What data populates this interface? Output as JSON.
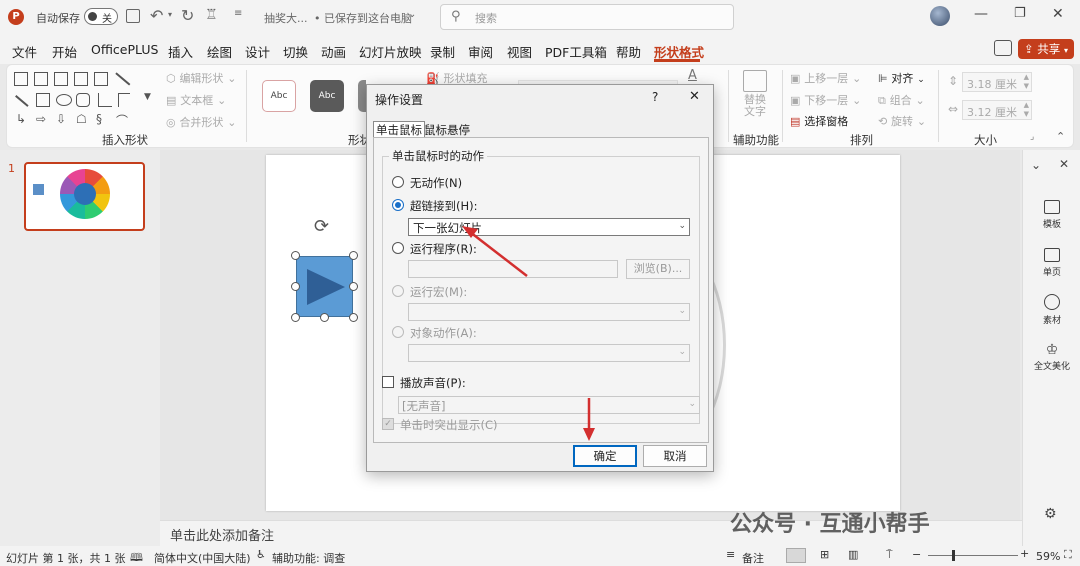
{
  "titlebar": {
    "autosave_label": "自动保存",
    "autosave_toggle": "关",
    "doc_title": "抽奖大...",
    "save_state": "• 已保存到这台电脑",
    "search_placeholder": "搜索"
  },
  "menu": {
    "items": [
      "文件",
      "开始",
      "OfficePLUS",
      "插入",
      "绘图",
      "设计",
      "切换",
      "动画",
      "幻灯片放映",
      "录制",
      "审阅",
      "视图",
      "PDF工具箱",
      "帮助",
      "形状格式"
    ],
    "share_label": "共享"
  },
  "ribbon": {
    "insert_shapes_label": "插入形状",
    "edit_shape": "编辑形状",
    "text_box": "文本框",
    "merge_shapes": "合并形状",
    "style_samples": [
      "Abc",
      "Abc",
      "Abc"
    ],
    "styles_label": "形状",
    "shape_fill": "形状填充",
    "alt_text": "替换文字",
    "accessibility_label": "辅助功能",
    "bring_forward": "上移一层",
    "send_backward": "下移一层",
    "selection_pane": "选择窗格",
    "align": "对齐",
    "group": "组合",
    "rotate": "旋转",
    "arrange_label": "排列",
    "height": "3.18 厘米",
    "width": "3.12 厘米",
    "size_label": "大小"
  },
  "thumbs": {
    "slide_number": "1"
  },
  "rightpane": {
    "items": [
      "模板",
      "单页",
      "素材",
      "全文美化"
    ]
  },
  "notes": {
    "placeholder": "单击此处添加备注"
  },
  "status": {
    "slide_info": "幻灯片 第 1 张，共 1 张",
    "language": "简体中文(中国大陆)",
    "accessibility": "辅助功能: 调查",
    "notes_btn": "备注",
    "zoom": "59%"
  },
  "watermark": "公众号 · 互通小帮手",
  "dialog": {
    "title": "操作设置",
    "help": "?",
    "close": "✕",
    "tabs": [
      "单击鼠标",
      "鼠标悬停"
    ],
    "group_title": "单击鼠标时的动作",
    "options": {
      "none": "无动作(N)",
      "hyperlink": "超链接到(H):",
      "hyperlink_value": "下一张幻灯片",
      "run_program": "运行程序(R):",
      "browse": "浏览(B)...",
      "run_macro": "运行宏(M):",
      "object_action": "对象动作(A):"
    },
    "play_sound": "播放声音(P):",
    "sound_value": "[无声音]",
    "highlight": "单击时突出显示(C)",
    "ok": "确定",
    "cancel": "取消"
  }
}
